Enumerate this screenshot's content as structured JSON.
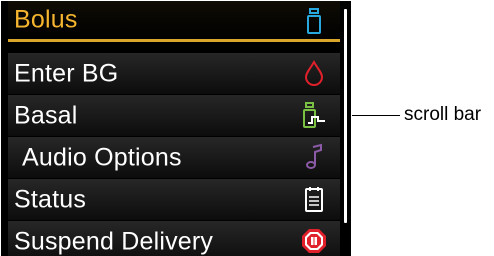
{
  "menu": {
    "items": [
      {
        "label": "Bolus",
        "icon": "insulin-cartridge-icon",
        "selected": true
      },
      {
        "label": "Enter BG",
        "icon": "blood-drop-icon",
        "selected": false
      },
      {
        "label": "Basal",
        "icon": "basal-cartridge-icon",
        "selected": false
      },
      {
        "label": "Audio Options",
        "icon": "music-note-icon",
        "selected": false
      },
      {
        "label": "Status",
        "icon": "clipboard-icon",
        "selected": false
      },
      {
        "label": "Suspend Delivery",
        "icon": "stop-pause-icon",
        "selected": false
      }
    ]
  },
  "annotation": {
    "scroll_bar_label": "scroll bar"
  },
  "colors": {
    "screen_background": "#000000",
    "selected_text": "#f5b52e",
    "selection_underline": "#d9a52a",
    "normal_text": "#ffffff",
    "bolus_icon": "#29a8e0",
    "bg_icon": "#e0202a",
    "basal_icon": "#7ac143",
    "audio_icon": "#8c5aa8",
    "status_icon": "#ffffff",
    "suspend_icon": "#e0202a"
  }
}
